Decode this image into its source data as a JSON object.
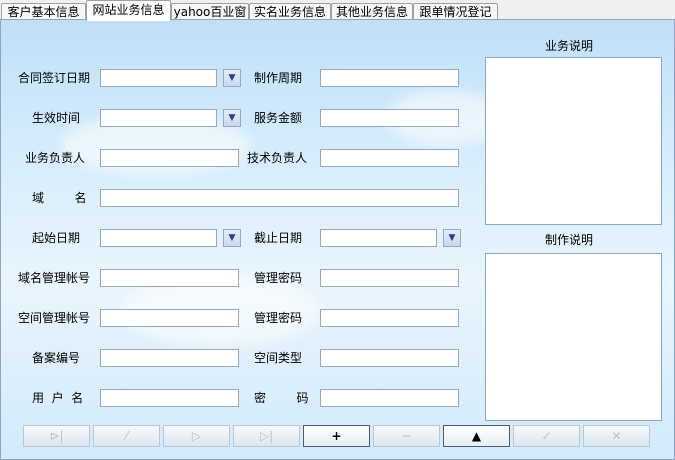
{
  "tabs": [
    "客户基本信息",
    "网站业务信息",
    "yahoo百业窗",
    "实名业务信息",
    "其他业务信息",
    "跟单情况登记"
  ],
  "form": {
    "contract_sign_date": "合同签订日期",
    "production_period": "制作周期",
    "effective_time": "生效时间",
    "service_amount": "服务金额",
    "business_manager": "业务负责人",
    "tech_manager": "技术负责人",
    "domain": "域        名",
    "start_date": "起始日期",
    "end_date": "截止日期",
    "domain_admin_account": "域名管理帐号",
    "manage_password_1": "管理密码",
    "space_admin_account": "空间管理帐号",
    "manage_password_2": "管理密码",
    "record_number": "备案编号",
    "space_type": "空间类型",
    "username": "用  户  名",
    "password": "密        码"
  },
  "side": {
    "business_desc": "业务说明",
    "production_desc": "制作说明"
  },
  "toolbar": {
    "first": "⊳|",
    "prev": "⁄",
    "next": "▷",
    "last": "▷|",
    "add": "+",
    "delete": "−",
    "edit": "▲",
    "save": "✓",
    "cancel": "✕"
  },
  "icons": {
    "dropdown": "chevron-down-icon"
  },
  "colors": {
    "panel_bg": "#d9eefc",
    "border": "#98a9bd"
  }
}
